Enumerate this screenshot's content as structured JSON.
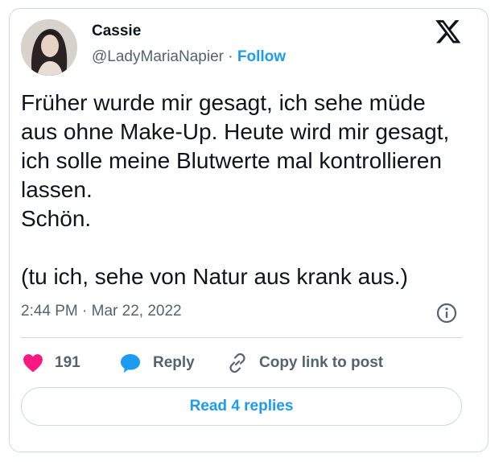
{
  "author": {
    "name": "Cassie",
    "handle": "@LadyMariaNapier",
    "separator": "·",
    "follow_label": "Follow"
  },
  "platform_icon": "x-logo-icon",
  "tweet": {
    "text": "Früher wurde mir gesagt, ich sehe müde aus ohne Make-Up. Heute wird mir gesagt, ich solle meine Blutwerte mal kontrollieren lassen.\nSchön.\n\n(tu ich, sehe von Natur aus krank aus.)",
    "timestamp": "2:44 PM · Mar 22, 2022"
  },
  "actions": {
    "like_count": "191",
    "reply_label": "Reply",
    "copy_label": "Copy link to post"
  },
  "read_replies_label": "Read 4 replies",
  "colors": {
    "accent": "#1d9bf0",
    "like": "#f91880",
    "text": "#0f1419",
    "muted": "#536471",
    "border": "#cfd9de"
  }
}
